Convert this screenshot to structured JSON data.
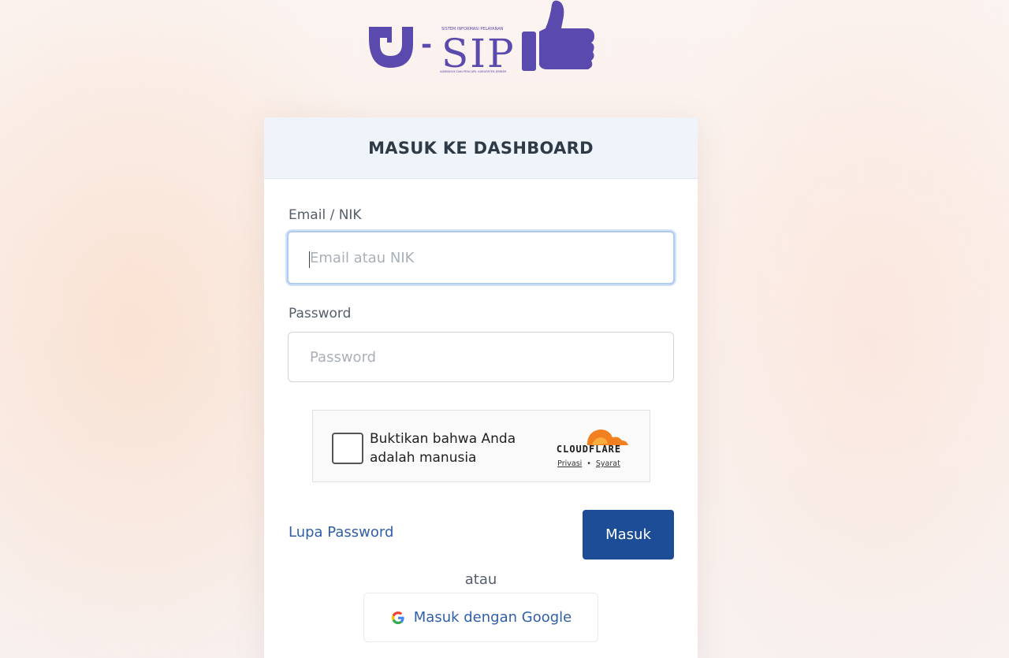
{
  "brand": {
    "prefix": "J",
    "dash": "-",
    "name": "SIP",
    "tagline_top": "SISTEM INFORMASI PELAYANAN",
    "tagline_bottom": "ADMINDUK DAN PENCAPIL KABUPATEN JEMBER",
    "color": "#5b4aad"
  },
  "form": {
    "title": "MASUK KE DASHBOARD",
    "email_label": "Email / NIK",
    "email_placeholder": "Email atau NIK",
    "password_label": "Password",
    "password_placeholder": "Password",
    "forgot_label": "Lupa Password",
    "submit_label": "Masuk",
    "or_label": "atau",
    "google_label": "Masuk dengan Google"
  },
  "captcha": {
    "text": "Buktikan bahwa Anda adalah manusia",
    "provider": "CLOUDFLARE",
    "privacy_label": "Privasi",
    "separator": "•",
    "terms_label": "Syarat"
  },
  "colors": {
    "primary_button": "#1d4d96",
    "link": "#2f5fa7",
    "cloudflare_orange": "#f38020"
  }
}
